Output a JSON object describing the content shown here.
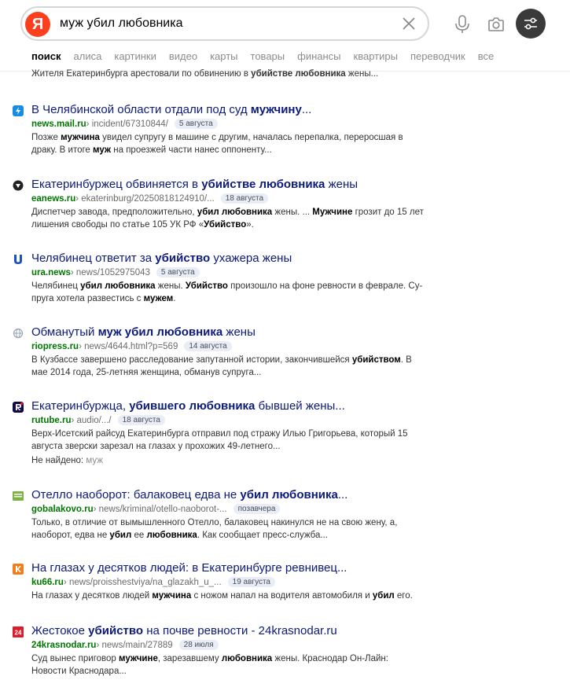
{
  "search": {
    "logo_letter": "Я",
    "query": "муж убил любовника"
  },
  "tabs": [
    "поиск",
    "алиса",
    "картинки",
    "видео",
    "карты",
    "товары",
    "финансы",
    "квартиры",
    "переводчик",
    "все"
  ],
  "top_snippet": {
    "pre": "Жителя Екатеринбурга арестовали по обвинению в ",
    "bold": "убийстве любовника",
    "post": " жены..."
  },
  "results": [
    {
      "icon": "lightning-icon",
      "icon_color": "#168de2",
      "title_parts": [
        [
          "В Челябинской области отдали под суд ",
          false
        ],
        [
          "мужчину",
          true
        ],
        [
          "...",
          false
        ]
      ],
      "host": "news.mail.ru",
      "path": " › incident/67310844/",
      "date": "5 августа",
      "desc_parts": [
        [
          "Позже ",
          false
        ],
        [
          "мужчина",
          true
        ],
        [
          " увидел супругу в машине с другим, началась перепалка, переросшая в драку. В итоге ",
          false
        ],
        [
          "муж",
          true
        ],
        [
          " на проезжей части нанес оппоненту...",
          false
        ]
      ]
    },
    {
      "icon": "eanews-icon",
      "icon_color": "#222222",
      "title_parts": [
        [
          "Екатеринбуржец обвиняется в ",
          false
        ],
        [
          "убийстве любовника",
          true
        ],
        [
          " жены",
          false
        ]
      ],
      "host": "eanews.ru",
      "path": " › ekaterinburg/20250818124910/...",
      "date": "18 августа",
      "desc_parts": [
        [
          "Диспетчер завода, предположительно, ",
          false
        ],
        [
          "убил любовника",
          true
        ],
        [
          " жены. ... ",
          false
        ],
        [
          "Мужчине",
          true
        ],
        [
          " грозит до 15 лет лишения свободы по статье 105 УК РФ «",
          false
        ],
        [
          "Убийство",
          true
        ],
        [
          "».",
          false
        ]
      ]
    },
    {
      "icon": "ura-icon",
      "icon_color": "#1f4fbf",
      "title_parts": [
        [
          "Челябинец ответит за ",
          false
        ],
        [
          "убийство",
          true
        ],
        [
          " ухажера жены",
          false
        ]
      ],
      "host": "ura.news",
      "path": " › news/1052975043",
      "date": "5 августа",
      "desc_parts": [
        [
          "Челябинец ",
          false
        ],
        [
          "убил любовника",
          true
        ],
        [
          " жены. ",
          false
        ],
        [
          "Убийство",
          true
        ],
        [
          " произошло на фоне ревности в феврале. Су-пруга хотела развестись с ",
          false
        ],
        [
          "мужем",
          true
        ],
        [
          ".",
          false
        ]
      ]
    },
    {
      "icon": "globe-icon",
      "icon_color": "#9aa4b5",
      "title_parts": [
        [
          "Обманутый ",
          false
        ],
        [
          "муж убил любовника",
          true
        ],
        [
          " жены",
          false
        ]
      ],
      "host": "riopress.ru",
      "path": " › news/4644.html?p=569",
      "date": "14 августа",
      "desc_parts": [
        [
          "В Кузбассе завершено расследование запутанной истории, закончившейся ",
          false
        ],
        [
          "убийством",
          true
        ],
        [
          ". В мае 2014 года, 25-летняя женщина, обманув супруга...",
          false
        ]
      ]
    },
    {
      "icon": "rutube-icon",
      "icon_color": "#100943",
      "title_parts": [
        [
          "Екатеринбуржца, ",
          false
        ],
        [
          "убившего любовника",
          true
        ],
        [
          " бывшей жены...",
          false
        ]
      ],
      "host": "rutube.ru",
      "path": " › audio/.../",
      "date": "18 августа",
      "desc_parts": [
        [
          "Верх-Исетский райсуд Екатеринбурга отправил под стражу Илью Григорьева, который 15 августа зверски зарезал на глазах у прохожих 49-летнего...",
          false
        ]
      ],
      "notfound_label": "Не найдено:",
      "notfound_word": "муж"
    },
    {
      "icon": "gobalakovo-icon",
      "icon_color": "#7cb342",
      "title_parts": [
        [
          "Отелло наоборот: балаковец едва не ",
          false
        ],
        [
          "убил любовника",
          true
        ],
        [
          "...",
          false
        ]
      ],
      "host": "gobalakovo.ru",
      "path": " › news/kriminal/otello-naoborot-...",
      "date": "позавчера",
      "desc_parts": [
        [
          "Только, в отличие от вымышленного Отелло, балаковец накинулся не на свою жену, а, наоборот, едва не ",
          false
        ],
        [
          "убил",
          true
        ],
        [
          " ее ",
          false
        ],
        [
          "любовника",
          true
        ],
        [
          ". Как сообщает пресс-служба...",
          false
        ]
      ]
    },
    {
      "icon": "ku66-icon",
      "icon_color": "#f07f1b",
      "title_parts": [
        [
          "На глазах у десятков людей: в Екатеринбурге ревнивец...",
          false
        ]
      ],
      "host": "ku66.ru",
      "path": " › news/proisshestviya/na_glazakh_u_...",
      "date": "19 августа",
      "desc_parts": [
        [
          "На глазах у десятков людей ",
          false
        ],
        [
          "мужчина",
          true
        ],
        [
          " с ножом напал на водителя автомобиля и ",
          false
        ],
        [
          "убил",
          true
        ],
        [
          " его.",
          false
        ]
      ]
    },
    {
      "icon": "24krasnodar-icon",
      "icon_color": "#d81e2c",
      "title_parts": [
        [
          "Жестокое ",
          false
        ],
        [
          "убийство",
          true
        ],
        [
          " на почве ревности - 24krasnodar.ru",
          false
        ]
      ],
      "host": "24krasnodar.ru",
      "path": " › news/main/27889",
      "date": "28 июля",
      "desc_parts": [
        [
          "Суд вынес приговор ",
          false
        ],
        [
          "мужчине",
          true
        ],
        [
          ", зарезавшему ",
          false
        ],
        [
          "любовника",
          true
        ],
        [
          " жены. Краснодар Он-Лайн: Новости Краснодара...",
          false
        ]
      ]
    }
  ]
}
